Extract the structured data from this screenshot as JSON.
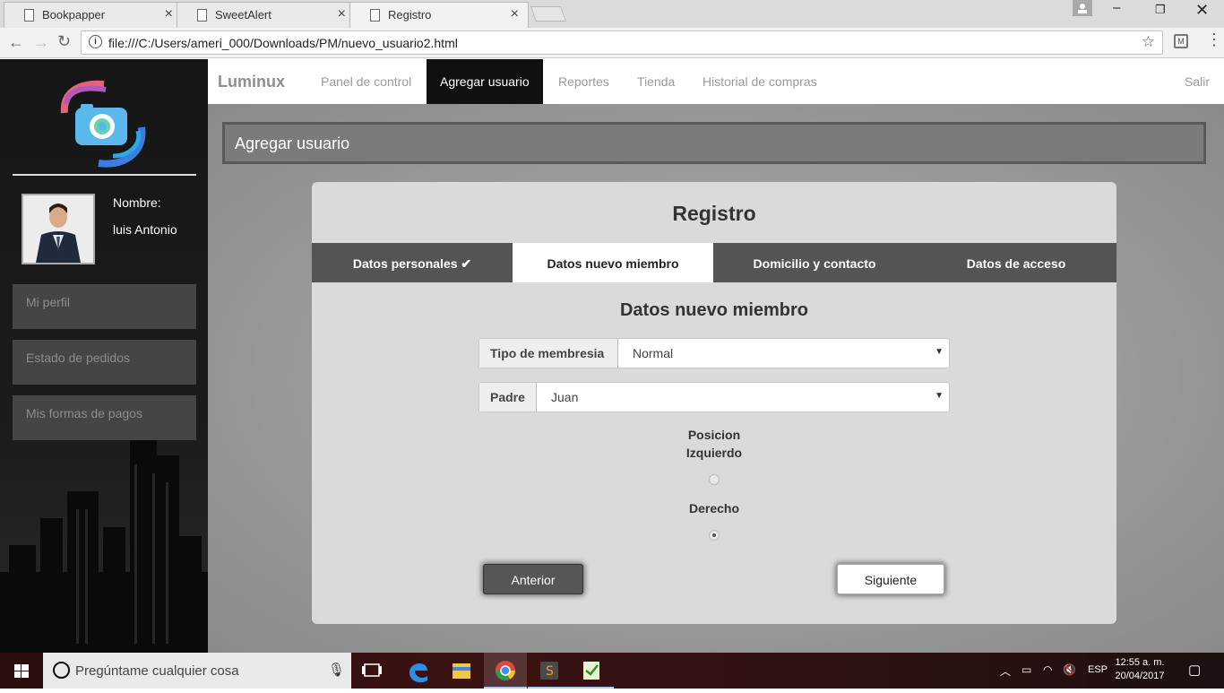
{
  "browser": {
    "tabs": [
      {
        "label": "Bookpapper"
      },
      {
        "label": "SweetAlert"
      },
      {
        "label": "Registro"
      }
    ],
    "url": "file:///C:/Users/ameri_000/Downloads/PM/nuevo_usuario2.html"
  },
  "sidebar": {
    "name_label": "Nombre:",
    "name_value": "luis Antonio",
    "menu": [
      {
        "label": "Mi perfil"
      },
      {
        "label": "Estado de pedidos"
      },
      {
        "label": "Mis formas de pagos"
      }
    ]
  },
  "topnav": {
    "brand": "Luminux",
    "items": [
      {
        "label": "Panel de control"
      },
      {
        "label": "Agregar usuario"
      },
      {
        "label": "Reportes"
      },
      {
        "label": "Tienda"
      },
      {
        "label": "Historial de compras"
      }
    ],
    "logout": "Salir"
  },
  "page": {
    "header": "Agregar usuario"
  },
  "form": {
    "title": "Registro",
    "steps": [
      {
        "label": "Datos personales ✔"
      },
      {
        "label": "Datos nuevo miembro"
      },
      {
        "label": "Domicilio y contacto"
      },
      {
        "label": "Datos de acceso"
      }
    ],
    "section_title": "Datos nuevo miembro",
    "membership_label": "Tipo de membresia",
    "membership_value": "Normal",
    "parent_label": "Padre",
    "parent_value": "Juan",
    "position_label": "Posicion",
    "left_label": "Izquierdo",
    "right_label": "Derecho",
    "selected_position": "Derecho",
    "prev_button": "Anterior",
    "next_button": "Siguiente"
  },
  "taskbar": {
    "search_placeholder": "Pregúntame cualquier cosa",
    "lang": "ESP",
    "time": "12:55 a. m.",
    "date": "20/04/2017"
  }
}
